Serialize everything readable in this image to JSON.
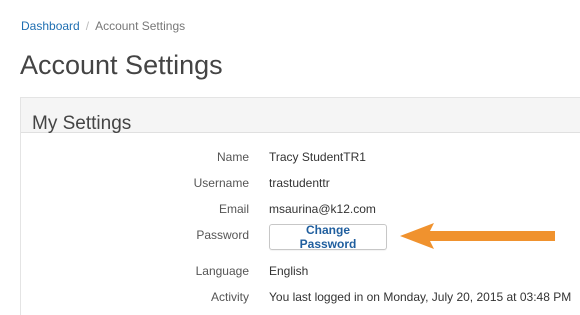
{
  "breadcrumb": {
    "home": "Dashboard",
    "separator": "/",
    "current": "Account Settings"
  },
  "page_title": "Account Settings",
  "settings": {
    "title": "My Settings",
    "name_label": "Name",
    "name_value": "Tracy StudentTR1",
    "username_label": "Username",
    "username_value": "trastudenttr",
    "email_label": "Email",
    "email_value": "msaurina@k12.com",
    "password_label": "Password",
    "change_password_label": "Change Password",
    "language_label": "Language",
    "language_value": "English",
    "activity_label": "Activity",
    "activity_value": "You last logged in on Monday, July 20, 2015 at 03:48 PM"
  },
  "colors": {
    "link": "#1f6fb2",
    "arrow": "#f0922e"
  },
  "icons": {
    "annotation": "arrow-left-icon"
  }
}
